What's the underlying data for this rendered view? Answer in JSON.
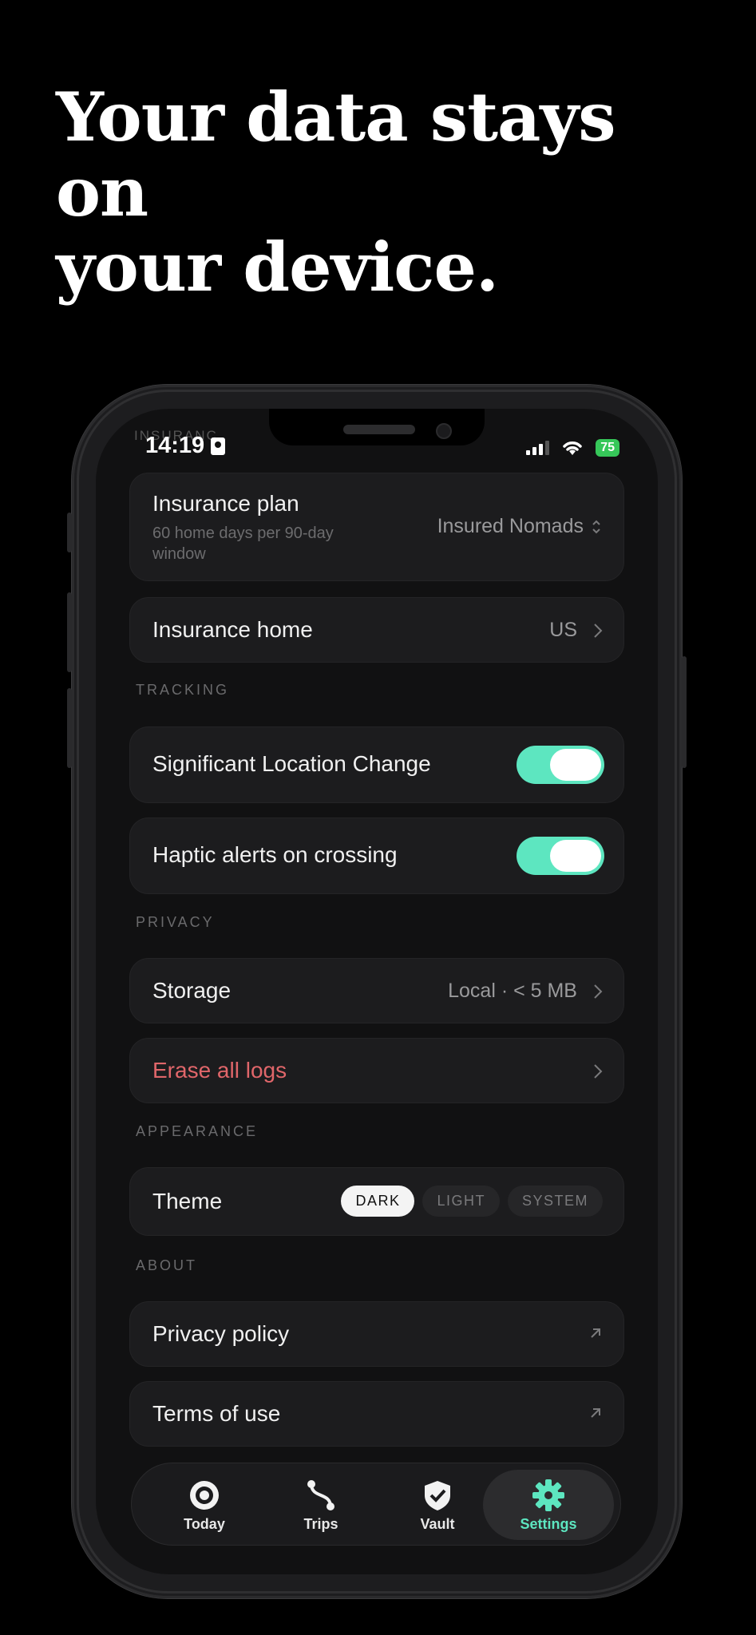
{
  "headline": {
    "line1": "Your data stays on",
    "line2": "your device."
  },
  "status_bar": {
    "time": "14:19",
    "battery": "75",
    "ghost_text": "INSURANC"
  },
  "insurance_plan": {
    "label": "Insurance plan",
    "sub": "60 home days per 90-day window",
    "value": "Insured Nomads"
  },
  "insurance_home": {
    "label": "Insurance home",
    "value": "US"
  },
  "sections": {
    "tracking": "TRACKING",
    "privacy": "PRIVACY",
    "appearance": "APPEARANCE",
    "about": "ABOUT"
  },
  "tracking": {
    "significant_location": {
      "label": "Significant Location Change",
      "enabled": true
    },
    "haptic_alerts": {
      "label": "Haptic alerts on crossing",
      "enabled": true
    }
  },
  "privacy": {
    "storage": {
      "label": "Storage",
      "value": "Local · < 5 MB"
    },
    "erase": {
      "label": "Erase all logs",
      "color": "#e0666a"
    }
  },
  "appearance": {
    "theme_label": "Theme",
    "options": [
      "DARK",
      "LIGHT",
      "SYSTEM"
    ],
    "selected": "DARK"
  },
  "about": {
    "privacy_policy": "Privacy policy",
    "terms": "Terms of use"
  },
  "tabbar": {
    "today": "Today",
    "trips": "Trips",
    "vault": "Vault",
    "settings": "Settings",
    "active": "Settings"
  },
  "colors": {
    "accent": "#5de6c0",
    "danger": "#e0666a",
    "background": "#000000",
    "card": "#1c1c1e"
  },
  "icons": {
    "chevron": "chevron-right-icon",
    "external": "external-link-icon",
    "updown": "chevron-updown-icon"
  }
}
